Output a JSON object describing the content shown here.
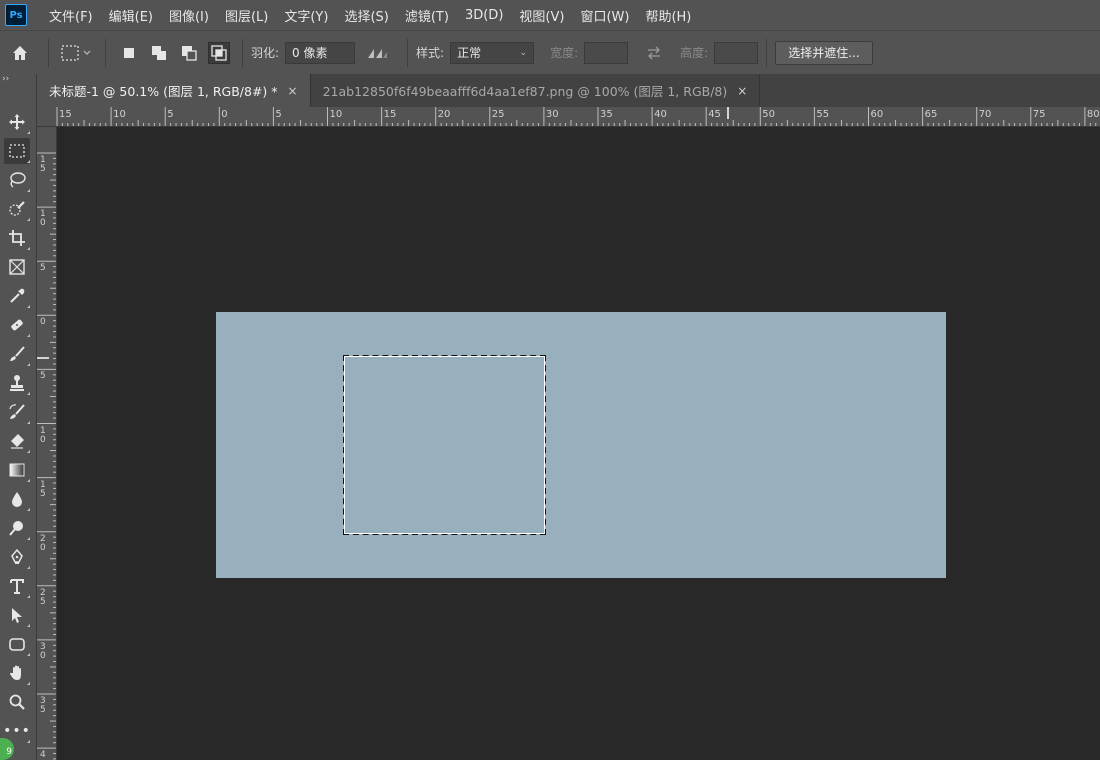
{
  "app": {
    "logo": "Ps"
  },
  "menu": [
    {
      "label": "文件(F)"
    },
    {
      "label": "编辑(E)"
    },
    {
      "label": "图像(I)"
    },
    {
      "label": "图层(L)"
    },
    {
      "label": "文字(Y)"
    },
    {
      "label": "选择(S)"
    },
    {
      "label": "滤镜(T)"
    },
    {
      "label": "3D(D)"
    },
    {
      "label": "视图(V)"
    },
    {
      "label": "窗口(W)"
    },
    {
      "label": "帮助(H)"
    }
  ],
  "options": {
    "feather_label": "羽化:",
    "feather_value": "0 像素",
    "style_label": "样式:",
    "style_value": "正常",
    "width_label": "宽度:",
    "height_label": "高度:",
    "select_mask_button": "选择并遮住..."
  },
  "tabs": [
    {
      "label": "未标题-1 @ 50.1% (图层 1, RGB/8#) *",
      "close": "×",
      "active": true
    },
    {
      "label": "21ab12850f6f49beaafff6d4aa1ef87.png @ 100% (图层 1, RGB/8)",
      "close": "×",
      "active": false
    }
  ],
  "ruler_h": [
    "15",
    "10",
    "5",
    "0",
    "5",
    "10",
    "15",
    "20",
    "25",
    "30",
    "35",
    "40",
    "45",
    "50",
    "55",
    "60",
    "65",
    "70",
    "75",
    "80"
  ],
  "ruler_v": [
    "1\n5",
    "1\n0",
    "5",
    "0",
    "5",
    "1\n0",
    "1\n5",
    "2\n0",
    "2\n5",
    "3\n0",
    "3\n5",
    "4"
  ],
  "toolbar_collapse": "››",
  "status_badge": "9",
  "colors": {
    "canvas_fill": "#98b0bd",
    "workspace_bg": "#282828",
    "chrome_bg": "#535353"
  }
}
